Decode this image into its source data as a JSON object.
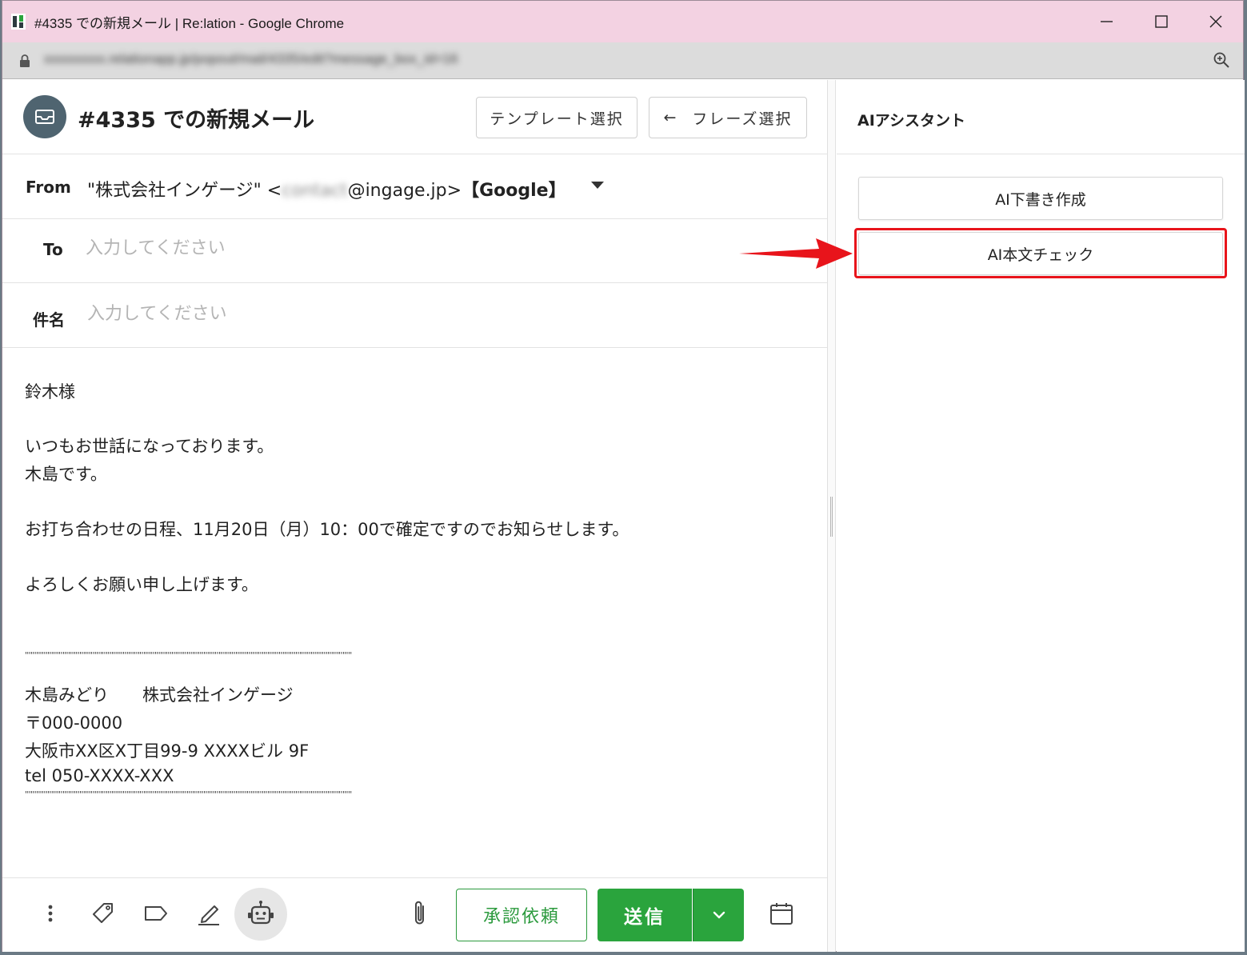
{
  "browser": {
    "window_title": "#4335 での新規メール | Re:lation - Google Chrome",
    "url": "xxxxxxxxx.relationapp.jp/popout/mail/4335/edit?message_box_id=16"
  },
  "header": {
    "title": "#4335 での新規メール",
    "template_button": "テンプレート選択",
    "phrase_button": "フレーズ選択"
  },
  "form": {
    "from_label": "From",
    "from_name": "\"株式会社インゲージ\" <",
    "from_user": "contact",
    "from_domain": "@ingage.jp>",
    "from_tag": "【Google】",
    "to_label": "To",
    "to_placeholder": "入力してください",
    "subject_label": "件名",
    "subject_placeholder": "入力してください"
  },
  "body": {
    "lines": [
      "鈴木様",
      "いつもお世話になっております。",
      "木島です。",
      "お打ち合わせの日程、11月20日（月）10：00で確定ですのでお知らせします。",
      "よろしくお願い申し上げます。",
      "''''''''''''''''''''''''''''''''''''''''''''''''''''''''''''''''''''''''''''''''''''''''''''''''''''''''''''''''''''''''''''''''''''''''''''''''''''''''''''''''''''''''''''''",
      "木島みどり　　株式会社インゲージ",
      "〒000-0000",
      "大阪市XX区X丁目99-9 XXXXビル 9F",
      "tel 050-XXXX-XXX",
      "''''''''''''''''''''''''''''''''''''''''''''''''''''''''''''''''''''''''''''''''''''''''''''''''''''''''''''''''''''''''''''''''''''''''''''''''''''''''''''''''''''''''''''''"
    ]
  },
  "toolbar": {
    "approve_button": "承認依頼",
    "send_button": "送信",
    "icons": [
      "more-vertical-icon",
      "tag-icon",
      "label-icon",
      "signature-icon",
      "robot-icon",
      "paperclip-icon",
      "chevron-down-icon",
      "calendar-icon"
    ]
  },
  "ai_panel": {
    "title": "AIアシスタント",
    "draft_button": "AI下書き作成",
    "check_button": "AI本文チェック"
  },
  "colors": {
    "accent_green": "#2aa43d",
    "highlight_red": "#e8141b",
    "titlebar_pink": "#f3d2e2",
    "avatar_slate": "#4f6470"
  }
}
